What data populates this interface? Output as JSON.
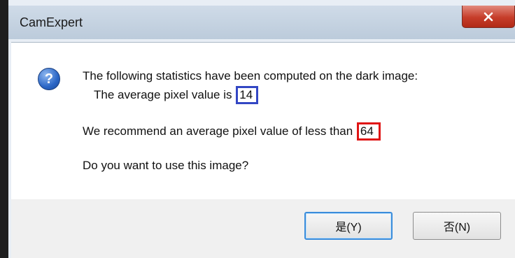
{
  "window": {
    "title": "CamExpert"
  },
  "icons": {
    "close": "close-icon",
    "question": "question-icon"
  },
  "message": {
    "line1": "The following statistics have been computed on the dark image:",
    "line2_prefix": "The average pixel value is ",
    "average_value": "14",
    "line3_prefix": "We recommend an average pixel value of less than ",
    "recommended_value": "64",
    "line4": "Do you want to use this image?"
  },
  "buttons": {
    "yes_label": "是(Y)",
    "no_label": "否(N)"
  },
  "highlight_colors": {
    "average_box": "#3347c4",
    "recommended_box": "#e01515"
  }
}
